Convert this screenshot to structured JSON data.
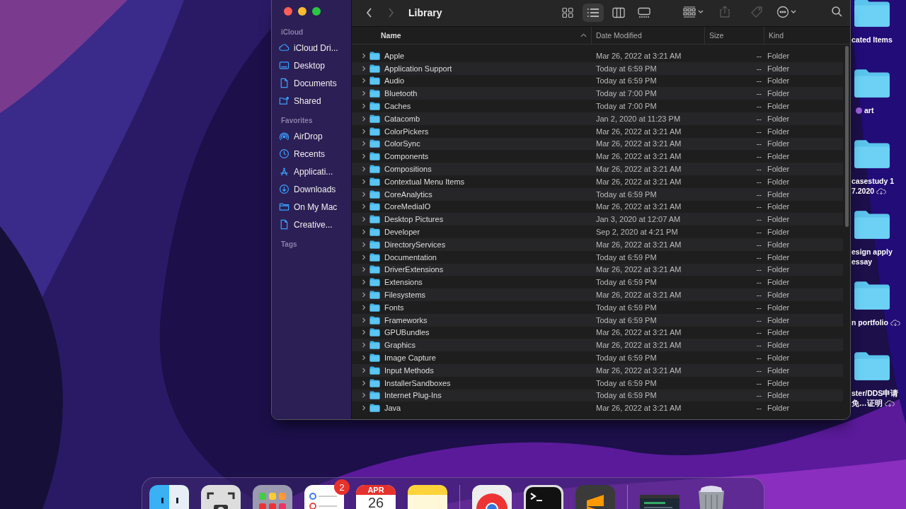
{
  "window": {
    "title": "Library"
  },
  "toolbar": {
    "views": [
      {
        "kind": "icons",
        "selected": false
      },
      {
        "kind": "list",
        "selected": true
      },
      {
        "kind": "columns",
        "selected": false
      },
      {
        "kind": "gallery",
        "selected": false
      }
    ],
    "actions": [
      {
        "kind": "group",
        "disabled": false
      },
      {
        "kind": "share",
        "disabled": true
      },
      {
        "kind": "tag",
        "disabled": true
      },
      {
        "kind": "more",
        "disabled": false
      },
      {
        "kind": "search",
        "disabled": false
      }
    ]
  },
  "sidebar": {
    "sections": [
      {
        "heading": "iCloud",
        "items": [
          {
            "label": "iCloud Dri...",
            "kind": "cloud"
          },
          {
            "label": "Desktop",
            "kind": "desktop"
          },
          {
            "label": "Documents",
            "kind": "document"
          },
          {
            "label": "Shared",
            "kind": "shared"
          }
        ]
      },
      {
        "heading": "Favorites",
        "items": [
          {
            "label": "AirDrop",
            "kind": "airdrop"
          },
          {
            "label": "Recents",
            "kind": "recents"
          },
          {
            "label": "Applicati...",
            "kind": "applications"
          },
          {
            "label": "Downloads",
            "kind": "downloads"
          },
          {
            "label": "On My Mac",
            "kind": "folder"
          },
          {
            "label": "Creative...",
            "kind": "file"
          }
        ]
      },
      {
        "heading": "Tags"
      }
    ]
  },
  "table": {
    "columns": [
      {
        "label": "Name",
        "sorted": true
      },
      {
        "label": "Date Modified",
        "sorted": false
      },
      {
        "label": "Size",
        "sorted": false
      },
      {
        "label": "Kind",
        "sorted": false
      }
    ],
    "rows": [
      {
        "name": "Apple",
        "date": "Mar 26, 2022 at 3:21 AM",
        "size": "--",
        "kind": "Folder",
        "expanded": false
      },
      {
        "name": "Application Support",
        "date": "Today at 6:59 PM",
        "size": "--",
        "kind": "Folder",
        "expanded": false
      },
      {
        "name": "Audio",
        "date": "Today at 6:59 PM",
        "size": "--",
        "kind": "Folder",
        "expanded": false
      },
      {
        "name": "Bluetooth",
        "date": "Today at 7:00 PM",
        "size": "--",
        "kind": "Folder",
        "expanded": false
      },
      {
        "name": "Caches",
        "date": "Today at 7:00 PM",
        "size": "--",
        "kind": "Folder",
        "expanded": false
      },
      {
        "name": "Catacomb",
        "date": "Jan 2, 2020 at 11:23 PM",
        "size": "--",
        "kind": "Folder",
        "expanded": false
      },
      {
        "name": "ColorPickers",
        "date": "Mar 26, 2022 at 3:21 AM",
        "size": "--",
        "kind": "Folder",
        "expanded": false
      },
      {
        "name": "ColorSync",
        "date": "Mar 26, 2022 at 3:21 AM",
        "size": "--",
        "kind": "Folder",
        "expanded": false
      },
      {
        "name": "Components",
        "date": "Mar 26, 2022 at 3:21 AM",
        "size": "--",
        "kind": "Folder",
        "expanded": false
      },
      {
        "name": "Compositions",
        "date": "Mar 26, 2022 at 3:21 AM",
        "size": "--",
        "kind": "Folder",
        "expanded": false
      },
      {
        "name": "Contextual Menu Items",
        "date": "Mar 26, 2022 at 3:21 AM",
        "size": "--",
        "kind": "Folder",
        "expanded": false
      },
      {
        "name": "CoreAnalytics",
        "date": "Today at 6:59 PM",
        "size": "--",
        "kind": "Folder",
        "expanded": false
      },
      {
        "name": "CoreMediaIO",
        "date": "Mar 26, 2022 at 3:21 AM",
        "size": "--",
        "kind": "Folder",
        "expanded": false
      },
      {
        "name": "Desktop Pictures",
        "date": "Jan 3, 2020 at 12:07 AM",
        "size": "--",
        "kind": "Folder",
        "expanded": false
      },
      {
        "name": "Developer",
        "date": "Sep 2, 2020 at 4:21 PM",
        "size": "--",
        "kind": "Folder",
        "expanded": false
      },
      {
        "name": "DirectoryServices",
        "date": "Mar 26, 2022 at 3:21 AM",
        "size": "--",
        "kind": "Folder",
        "expanded": false
      },
      {
        "name": "Documentation",
        "date": "Today at 6:59 PM",
        "size": "--",
        "kind": "Folder",
        "expanded": false
      },
      {
        "name": "DriverExtensions",
        "date": "Mar 26, 2022 at 3:21 AM",
        "size": "--",
        "kind": "Folder",
        "expanded": false
      },
      {
        "name": "Extensions",
        "date": "Today at 6:59 PM",
        "size": "--",
        "kind": "Folder",
        "expanded": false
      },
      {
        "name": "Filesystems",
        "date": "Mar 26, 2022 at 3:21 AM",
        "size": "--",
        "kind": "Folder",
        "expanded": false
      },
      {
        "name": "Fonts",
        "date": "Today at 6:59 PM",
        "size": "--",
        "kind": "Folder",
        "expanded": false
      },
      {
        "name": "Frameworks",
        "date": "Today at 6:59 PM",
        "size": "--",
        "kind": "Folder",
        "expanded": false
      },
      {
        "name": "GPUBundles",
        "date": "Mar 26, 2022 at 3:21 AM",
        "size": "--",
        "kind": "Folder",
        "expanded": false
      },
      {
        "name": "Graphics",
        "date": "Mar 26, 2022 at 3:21 AM",
        "size": "--",
        "kind": "Folder",
        "expanded": false
      },
      {
        "name": "Image Capture",
        "date": "Today at 6:59 PM",
        "size": "--",
        "kind": "Folder",
        "expanded": false
      },
      {
        "name": "Input Methods",
        "date": "Mar 26, 2022 at 3:21 AM",
        "size": "--",
        "kind": "Folder",
        "expanded": false
      },
      {
        "name": "InstallerSandboxes",
        "date": "Today at 6:59 PM",
        "size": "--",
        "kind": "Folder",
        "expanded": false
      },
      {
        "name": "Internet Plug-Ins",
        "date": "Today at 6:59 PM",
        "size": "--",
        "kind": "Folder",
        "expanded": false
      },
      {
        "name": "Java",
        "date": "Mar 26, 2022 at 3:21 AM",
        "size": "--",
        "kind": "Folder",
        "expanded": false
      }
    ]
  },
  "desktop_items": [
    {
      "lines": [
        "cated Items"
      ],
      "icloud": false
    },
    {
      "lines": [
        "art"
      ],
      "icloud": false,
      "color": "#9b5fd6"
    },
    {
      "lines": [
        "casestudy 1",
        "7.2020"
      ],
      "icloud": true
    },
    {
      "lines": [
        "esign apply",
        "essay"
      ],
      "icloud": false
    },
    {
      "lines": [
        "n portfolio"
      ],
      "icloud": true
    },
    {
      "lines": [
        "ster/DDS申请",
        "免…证明"
      ],
      "icloud": true
    }
  ],
  "dock": [
    {
      "kind": "finder"
    },
    {
      "kind": "screenshot"
    },
    {
      "kind": "launchpad"
    },
    {
      "kind": "reminders",
      "badge": "2"
    },
    {
      "kind": "calendar",
      "month": "APR",
      "day": "26"
    },
    {
      "kind": "notes"
    },
    {
      "kind": "separator"
    },
    {
      "kind": "chrome"
    },
    {
      "kind": "terminal"
    },
    {
      "kind": "sublime"
    },
    {
      "kind": "separator"
    },
    {
      "kind": "window-thumbnail"
    },
    {
      "kind": "trash"
    }
  ]
}
